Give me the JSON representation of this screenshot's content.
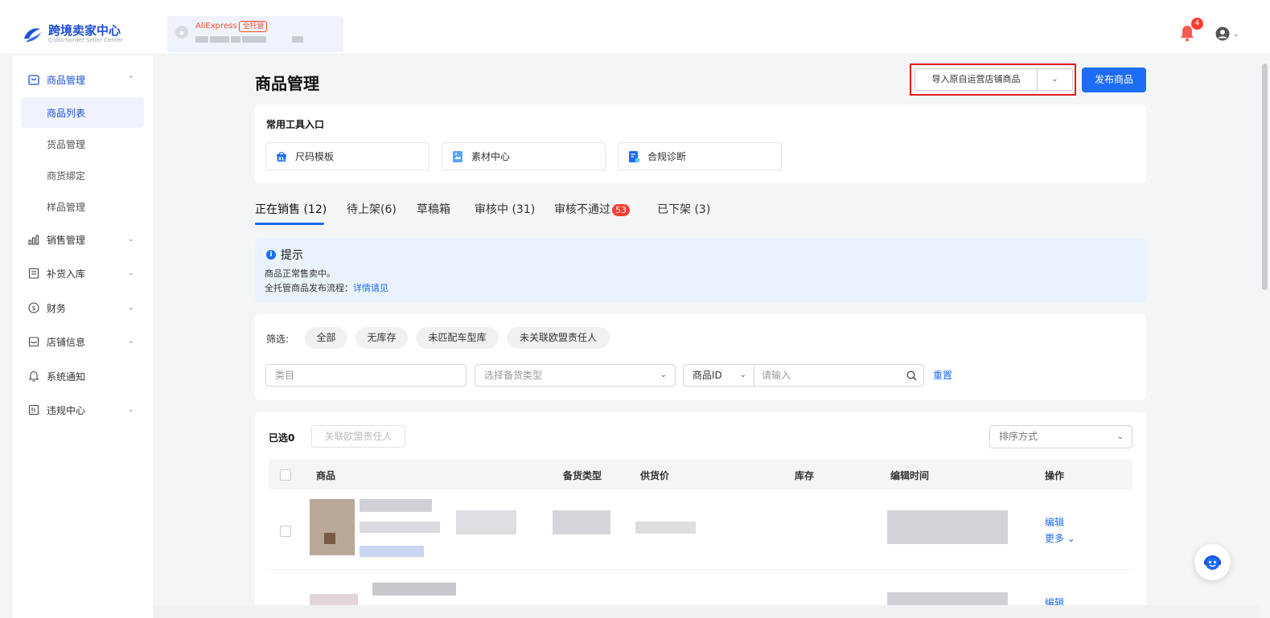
{
  "header": {
    "app_title": "跨境卖家中心",
    "app_subtitle": "Cross-border Seller Center",
    "store_platform": "AliExpress",
    "store_mode_badge": "全托管",
    "notification_count": "4"
  },
  "sidebar": {
    "groups": [
      {
        "label": "商品管理",
        "icon": "box-icon",
        "expanded": true,
        "children": [
          "商品列表",
          "货品管理",
          "商货绑定",
          "样品管理"
        ],
        "active_child": "商品列表"
      },
      {
        "label": "销售管理",
        "icon": "bar-chart-icon"
      },
      {
        "label": "补货入库",
        "icon": "clipboard-icon"
      },
      {
        "label": "财务",
        "icon": "dollar-circle-icon"
      },
      {
        "label": "店铺信息",
        "icon": "store-icon"
      },
      {
        "label": "系统通知",
        "icon": "bell-icon"
      },
      {
        "label": "违规中心",
        "icon": "alert-document-icon"
      }
    ]
  },
  "main": {
    "title": "商品管理",
    "import_button": "导入原自运营店铺商品",
    "publish_button": "发布商品",
    "tools": {
      "title": "常用工具入口",
      "items": [
        "尺码模板",
        "素材中心",
        "合规诊断"
      ]
    },
    "tabs": [
      {
        "label": "正在销售 (12)",
        "active": true
      },
      {
        "label": "待上架(6)"
      },
      {
        "label": "草稿箱"
      },
      {
        "label": "审核中 (31)"
      },
      {
        "label": "审核不通过",
        "badge": "53"
      },
      {
        "label": "已下架 (3)"
      }
    ],
    "tip": {
      "title": "提示",
      "line1": "商品正常售卖中。",
      "line2_prefix": "全托管商品发布流程：",
      "line2_link": "详情请见"
    },
    "filter": {
      "label": "筛选:",
      "chips": [
        "全部",
        "无库存",
        "未匹配车型库",
        "未关联欧盟责任人"
      ],
      "category_placeholder": "类目",
      "stock_type_placeholder": "选择备货类型",
      "id_select": "商品ID",
      "id_placeholder": "请输入",
      "reset": "重置"
    },
    "table": {
      "selected_label": "已选0",
      "link_eu_button": "关联欧盟责任人",
      "sort_placeholder": "排序方式",
      "columns": [
        "商品",
        "备货类型",
        "供货价",
        "库存",
        "编辑时间",
        "操作"
      ],
      "row_actions": {
        "edit": "编辑",
        "more": "更多"
      }
    }
  }
}
